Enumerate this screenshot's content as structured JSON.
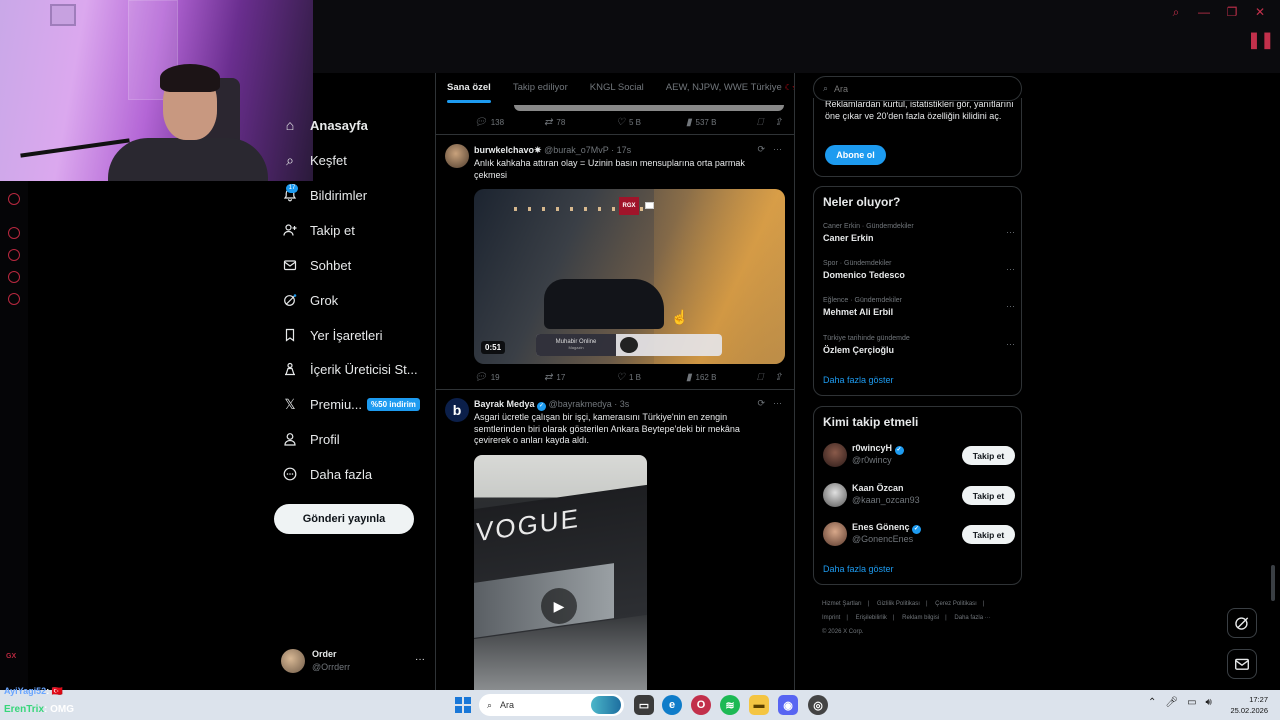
{
  "browser": {
    "window_controls": [
      "search",
      "minimize",
      "restore",
      "close"
    ],
    "accent": "#c2304b"
  },
  "nav": {
    "items": [
      {
        "label": "Anasayfa",
        "icon": "home-icon"
      },
      {
        "label": "Keşfet",
        "icon": "search-icon"
      },
      {
        "label": "Bildirimler",
        "icon": "bell-icon",
        "badge": "17"
      },
      {
        "label": "Takip et",
        "icon": "person-add-icon"
      },
      {
        "label": "Sohbet",
        "icon": "envelope-icon"
      },
      {
        "label": "Grok",
        "icon": "grok-icon"
      },
      {
        "label": "Yer İşaretleri",
        "icon": "bookmark-icon"
      },
      {
        "label": "İçerik Üreticisi St...",
        "icon": "creator-studio-icon"
      },
      {
        "label": "Premiu...",
        "icon": "x-logo-icon",
        "tag": "%50 indirim"
      },
      {
        "label": "Profil",
        "icon": "person-icon"
      },
      {
        "label": "Daha fazla",
        "icon": "more-circle-icon"
      }
    ],
    "post_button": "Gönderi yayınla",
    "account": {
      "name": "Order",
      "handle": "@Orrderr"
    }
  },
  "feed": {
    "tabs": [
      "Sana özel",
      "Takip ediliyor",
      "KNGL Social",
      "AEW, NJPW, WWE Türkiye"
    ],
    "active_tab": "Sana özel",
    "prev_actions": {
      "replies": "138",
      "reposts": "78",
      "likes": "5 B",
      "views": "537 B"
    },
    "tweets": [
      {
        "name": "burwkelchavo✷",
        "handle": "@burak_o7MvP",
        "time": "· 17s",
        "text": "Anlık kahkaha attıran olay = Uzinin basın mensuplarına orta parmak çekmesi",
        "media": {
          "type": "video",
          "duration": "0:51",
          "overlay_label": "Muhabir Online",
          "overlay_sub": "Magazin",
          "badge": "RGX"
        },
        "actions": {
          "replies": "19",
          "reposts": "17",
          "likes": "1 B",
          "views": "162 B"
        }
      },
      {
        "name": "Bayrak Medya",
        "handle": "@bayrakmedya",
        "time": "· 3s",
        "verified": true,
        "avatar_letter": "b",
        "text": "Asgari ücretle çalışan bir işçi, kameraısını Türkiye'nin en zengin semtlerinden biri olarak gösterilen Ankara Beytepe'deki bir mekâna çevirerek o anları kayda aldı.",
        "media": {
          "type": "video",
          "sign_text": "VOGUE"
        }
      }
    ]
  },
  "sidebar": {
    "search_placeholder": "Ara",
    "premium": {
      "text": "Reklamlardan kurtul, istatistikleri gör, yanıtlarını öne çıkar ve 20'den fazla özelliğin kilidini aç.",
      "button": "Abone ol"
    },
    "trends": {
      "title": "Neler oluyor?",
      "items": [
        {
          "meta": "Caner Erkin · Gündemdekiler",
          "name": "Caner Erkin"
        },
        {
          "meta": "Spor · Gündemdekiler",
          "name": "Domenico Tedesco"
        },
        {
          "meta": "Eğlence · Gündemdekiler",
          "name": "Mehmet Ali Erbil"
        },
        {
          "meta": "Türkiye tarihinde gündemde",
          "name": "Özlem Çerçioğlu"
        }
      ],
      "show_more": "Daha fazla göster"
    },
    "who_to_follow": {
      "title": "Kimi takip etmeli",
      "items": [
        {
          "name": "r0wincyH",
          "handle": "@r0wincy",
          "verified": true
        },
        {
          "name": "Kaan Özcan",
          "handle": "@kaan_ozcan93",
          "verified": false
        },
        {
          "name": "Enes Gönenç",
          "handle": "@GonencEnes",
          "verified": true
        }
      ],
      "follow_label": "Takip et",
      "show_more": "Daha fazla göster"
    },
    "footer": [
      "Hizmet Şartları",
      "|",
      "Gizlilik Politikası",
      "|",
      "Çerez Politikası",
      "|",
      "Imprint",
      "|",
      "Erişilebilirlik",
      "|",
      "Reklam bilgisi",
      "|",
      "Daha fazla ···",
      "© 2026 X Corp."
    ]
  },
  "overlay_chat": [
    {
      "user": "AyiYagi52",
      "text": ": 🇹🇷"
    },
    {
      "user": "ErenTrix",
      "text": ": OMG"
    }
  ],
  "taskbar": {
    "search_placeholder": "Ara",
    "time": "17:27",
    "date": "25.02.2026"
  }
}
